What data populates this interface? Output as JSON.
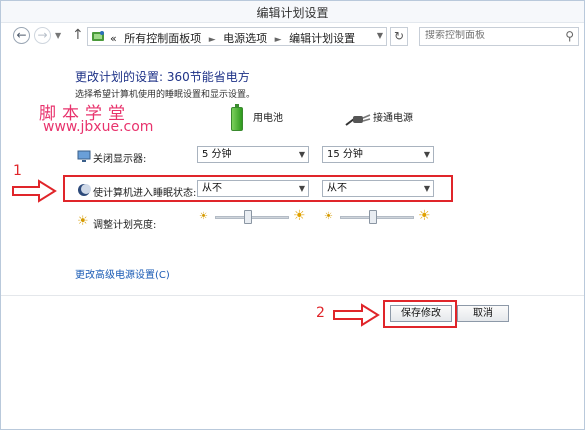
{
  "window": {
    "title": "编辑计划设置"
  },
  "address": {
    "overflow": "«",
    "crumbs": [
      "所有控制面板项",
      "电源选项",
      "编辑计划设置"
    ],
    "search_placeholder": "搜索控制面板"
  },
  "main": {
    "heading": "更改计划的设置: 360节能省电方",
    "subtext": "选择希望计算机使用的睡眠设置和显示设置。",
    "watermark_name": "脚本学堂",
    "watermark_url": "www.jbxue.com",
    "col_battery": "用电池",
    "col_plugged": "接通电源",
    "rows": [
      {
        "label": "关闭显示器:",
        "battery_value": "5 分钟",
        "plugged_value": "15 分钟"
      },
      {
        "label": "使计算机进入睡眠状态:",
        "battery_value": "从不",
        "plugged_value": "从不"
      },
      {
        "label": "调整计划亮度:",
        "battery_brightness_percent": 45,
        "plugged_brightness_percent": 45
      }
    ],
    "advanced_link": "更改高级电源设置(C)"
  },
  "footer": {
    "save_label": "保存修改",
    "cancel_label": "取消"
  },
  "annotations": {
    "label_1": "1",
    "label_2": "2",
    "color": "#e0252a"
  }
}
